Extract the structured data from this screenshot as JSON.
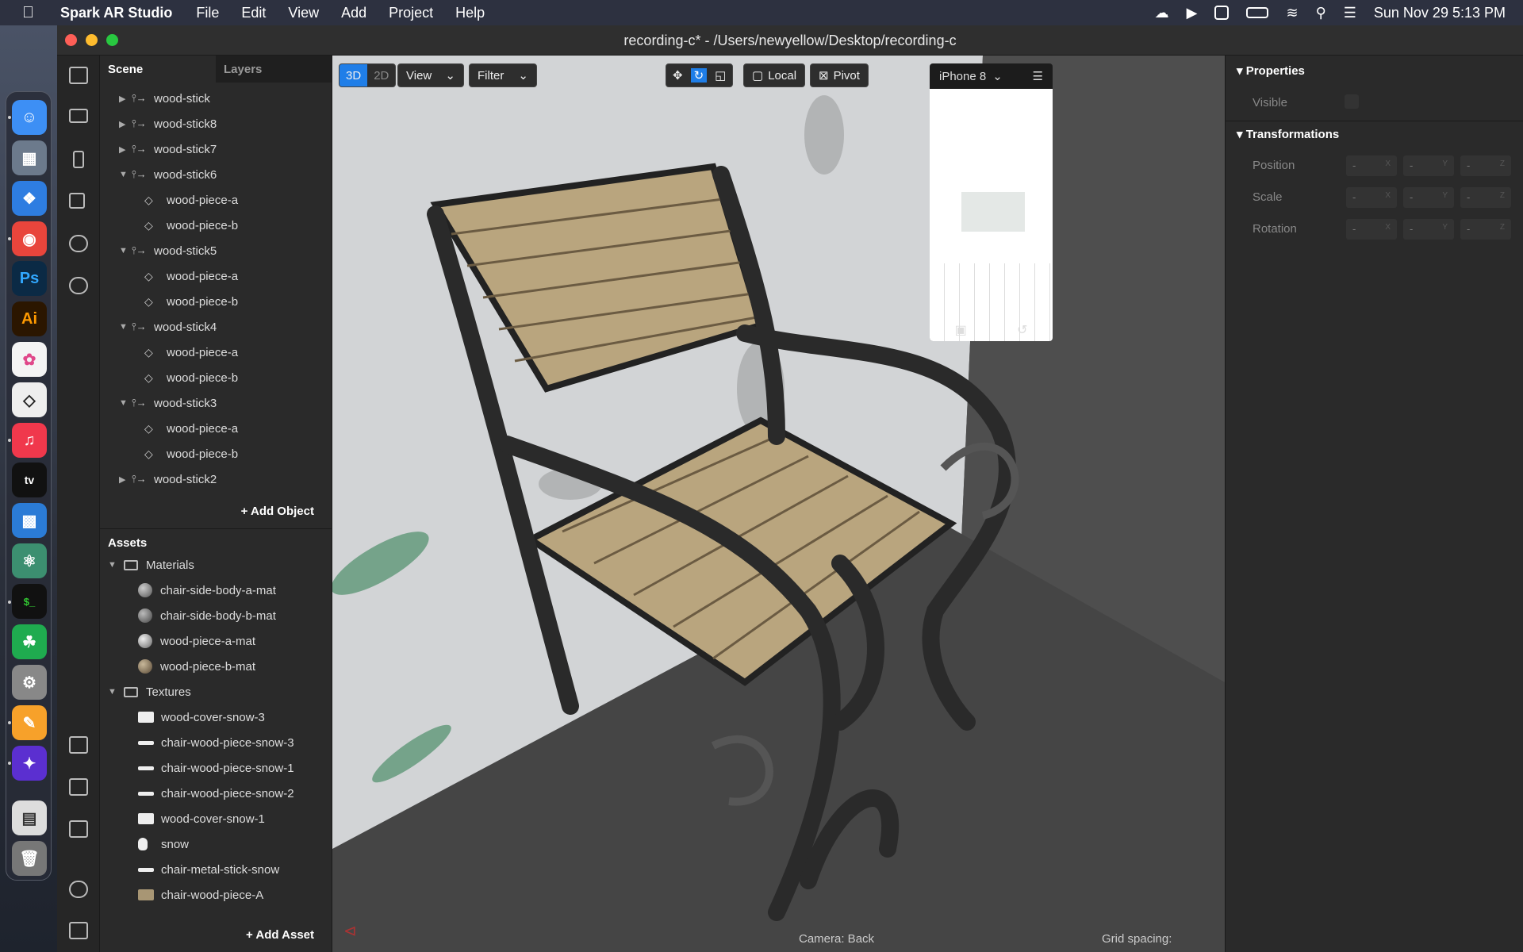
{
  "menubar": {
    "app": "Spark AR Studio",
    "items": [
      "File",
      "Edit",
      "View",
      "Add",
      "Project",
      "Help"
    ],
    "clock": "Sun Nov 29  5:13 PM"
  },
  "window": {
    "title": "recording-c* - /Users/newyellow/Desktop/recording-c"
  },
  "scene": {
    "tab_scene": "Scene",
    "tab_layers": "Layers",
    "add_object": "Add Object",
    "tree": [
      {
        "label": "wood-stick",
        "kind": "null",
        "depth": 0,
        "state": "collapsed"
      },
      {
        "label": "wood-stick8",
        "kind": "null",
        "depth": 0,
        "state": "collapsed"
      },
      {
        "label": "wood-stick7",
        "kind": "null",
        "depth": 0,
        "state": "collapsed"
      },
      {
        "label": "wood-stick6",
        "kind": "null",
        "depth": 0,
        "state": "expanded"
      },
      {
        "label": "wood-piece-a",
        "kind": "mesh",
        "depth": 1,
        "state": "none"
      },
      {
        "label": "wood-piece-b",
        "kind": "mesh",
        "depth": 1,
        "state": "none"
      },
      {
        "label": "wood-stick5",
        "kind": "null",
        "depth": 0,
        "state": "expanded"
      },
      {
        "label": "wood-piece-a",
        "kind": "mesh",
        "depth": 1,
        "state": "none"
      },
      {
        "label": "wood-piece-b",
        "kind": "mesh",
        "depth": 1,
        "state": "none"
      },
      {
        "label": "wood-stick4",
        "kind": "null",
        "depth": 0,
        "state": "expanded"
      },
      {
        "label": "wood-piece-a",
        "kind": "mesh",
        "depth": 1,
        "state": "none"
      },
      {
        "label": "wood-piece-b",
        "kind": "mesh",
        "depth": 1,
        "state": "none"
      },
      {
        "label": "wood-stick3",
        "kind": "null",
        "depth": 0,
        "state": "expanded"
      },
      {
        "label": "wood-piece-a",
        "kind": "mesh",
        "depth": 1,
        "state": "none"
      },
      {
        "label": "wood-piece-b",
        "kind": "mesh",
        "depth": 1,
        "state": "none"
      },
      {
        "label": "wood-stick2",
        "kind": "null",
        "depth": 0,
        "state": "collapsed"
      }
    ]
  },
  "assets": {
    "title": "Assets",
    "add_asset": "Add Asset",
    "materials_label": "Materials",
    "textures_label": "Textures",
    "materials": [
      "chair-side-body-a-mat",
      "chair-side-body-b-mat",
      "wood-piece-a-mat",
      "wood-piece-b-mat"
    ],
    "textures": [
      "wood-cover-snow-3",
      "chair-wood-piece-snow-3",
      "chair-wood-piece-snow-1",
      "chair-wood-piece-snow-2",
      "wood-cover-snow-1",
      "snow",
      "chair-metal-stick-snow",
      "chair-wood-piece-A"
    ]
  },
  "viewport": {
    "mode_3d": "3D",
    "mode_2d": "2D",
    "view": "View",
    "filter": "Filter",
    "local": "Local",
    "pivot": "Pivot",
    "device": "iPhone 8",
    "camera": "Camera: Back",
    "grid": "Grid spacing:"
  },
  "properties": {
    "header": "Properties",
    "visible": "Visible",
    "transform_header": "Transformations",
    "rows": [
      "Position",
      "Scale",
      "Rotation"
    ],
    "placeholder": "-",
    "axes": [
      "X",
      "Y",
      "Z"
    ]
  }
}
